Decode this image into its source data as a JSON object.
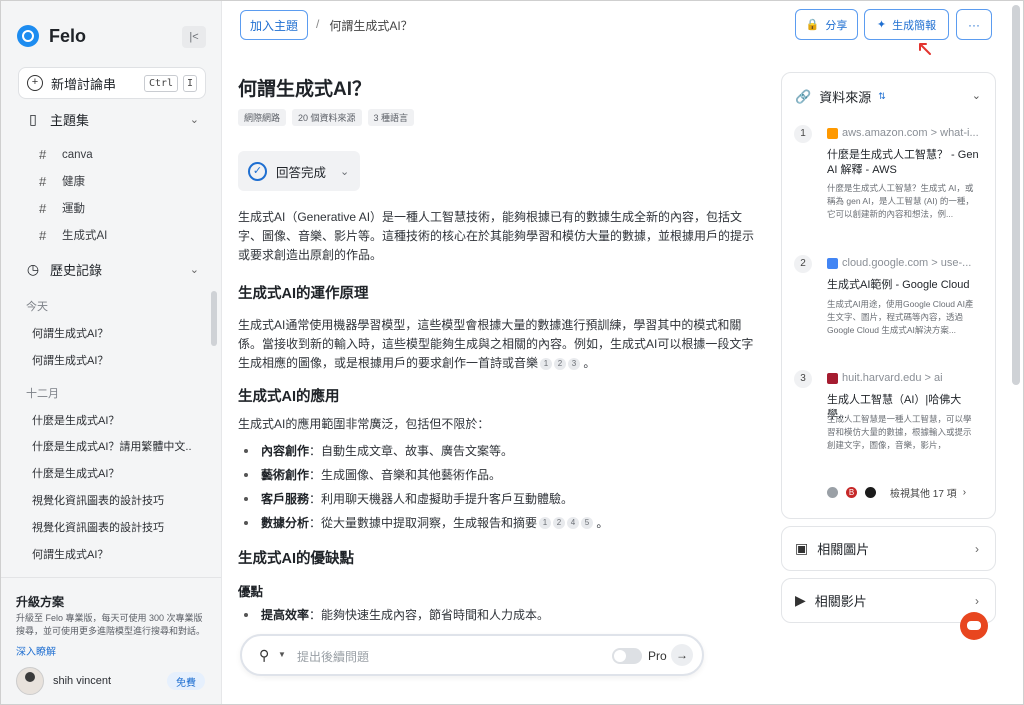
{
  "app": {
    "name": "Felo",
    "collapse_icon": "|<"
  },
  "sidebar": {
    "new_thread": {
      "label": "新增討論串",
      "shortcut_ctrl": "Ctrl",
      "shortcut_key": "I"
    },
    "topics_label": "主題集",
    "topics": [
      "canva",
      "健康",
      "運動",
      "生成式AI"
    ],
    "history_label": "歷史記錄",
    "history_groups": [
      {
        "label": "今天",
        "items": [
          "何謂生成式AI？",
          "何謂生成式AI？"
        ]
      },
      {
        "label": "十二月",
        "items": [
          "什麼是生成式AI？",
          "什麼是生成式AI？請用繁體中文...",
          "什麼是生成式AI？",
          "視覺化資訊圖表的設計技巧",
          "視覺化資訊圖表的設計技巧",
          "何謂生成式AI？"
        ]
      }
    ],
    "upgrade": {
      "title": "升級方案",
      "desc": "升級至 Felo 專業版，每天可使用 300 次專業版搜尋，並可使用更多進階模型進行搜尋和對話。",
      "more": "深入瞭解"
    },
    "user": {
      "name": "shih vincent",
      "plan": "免費"
    }
  },
  "topbar": {
    "add_topic": "加入主題",
    "breadcrumb": "何謂生成式AI？",
    "share": "分享",
    "generate_report": "生成簡報",
    "more": "···"
  },
  "main": {
    "title": "何謂生成式AI？",
    "chips": [
      "網際網路",
      "20 個資料來源",
      "3 種語言"
    ],
    "status": "回答完成",
    "intro": "生成式AI（Generative AI）是一種人工智慧技術，能夠根據已有的數據生成全新的內容，包括文字、圖像、音樂、影片等。這種技術的核心在於其能夠學習和模仿大量的數據，並根據用戶的提示或要求創造出原創的作品。",
    "h_principle": "生成式AI的運作原理",
    "principle": "生成式AI通常使用機器學習模型，這些模型會根據大量的數據進行預訓練，學習其中的模式和關係。當接收到新的輸入時，這些模型能夠生成與之相關的內容。例如，生成式AI可以根據一段文字生成相應的圖像，或是根據用戶的要求創作一首詩或音樂",
    "principle_cites": [
      "1",
      "2",
      "3"
    ],
    "h_apps": "生成式AI的應用",
    "apps_intro": "生成式AI的應用範圍非常廣泛，包括但不限於：",
    "apps": [
      {
        "k": "內容創作",
        "v": "：自動生成文章、故事、廣告文案等。"
      },
      {
        "k": "藝術創作",
        "v": "：生成圖像、音樂和其他藝術作品。"
      },
      {
        "k": "客戶服務",
        "v": "：利用聊天機器人和虛擬助手提升客戶互動體驗。"
      },
      {
        "k": "數據分析",
        "v": "：從大量數據中提取洞察，生成報告和摘要"
      }
    ],
    "apps_cites": [
      "1",
      "2",
      "4",
      "5"
    ],
    "h_proscons": "生成式AI的優缺點",
    "h_pros": "優點",
    "pros": [
      {
        "k": "提高效率",
        "v": "：能夠快速生成內容，節省時間和人力成本。"
      }
    ],
    "ask_placeholder": "提出後續問題",
    "pro_label": "Pro"
  },
  "sources": {
    "title": "資料來源",
    "items": [
      {
        "num": "1",
        "domain": "aws.amazon.com > what-i...",
        "title": "什麼是生成式人工智慧？ - Gen AI 解釋 - AWS",
        "snippet": "什麼是生成式人工智慧？生成式 AI，或稱為 gen AI，是人工智慧 (AI) 的一種，它可以創建新的內容和想法，例...",
        "fav_color": "#ff9900"
      },
      {
        "num": "2",
        "domain": "cloud.google.com > use-...",
        "title": "生成式AI範例 - Google Cloud",
        "snippet": "生成式AI用途，使用Google Cloud AI產生文字、圖片，程式碼等內容，透過Google Cloud 生成式AI解決方案...",
        "fav_color": "#4285f4"
      },
      {
        "num": "3",
        "domain": "huit.harvard.edu > ai",
        "title": "生成人工智慧（AI）|哈佛大學...",
        "snippet": "生成人工智慧是一種人工智慧，可以學習和模仿大量的數據，根據輸入或提示創建文字，圖像，音樂，影片，",
        "fav_color": "#a51c30"
      }
    ],
    "more_label": "檢視其他 17 項"
  },
  "related_images": "相關圖片",
  "related_videos": "相關影片"
}
